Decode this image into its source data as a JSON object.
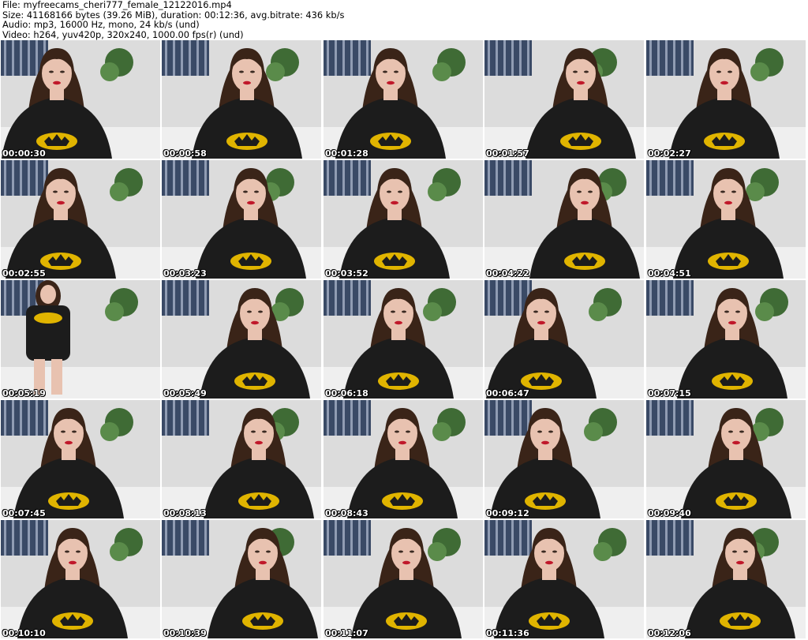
{
  "header": {
    "file_line": "File: myfreecams_cheri777_female_12122016.mp4",
    "size_line": "Size: 41168166 bytes (39.26 MiB), duration: 00:12:36, avg.bitrate: 436 kb/s",
    "audio_line": "Audio: mp3, 16000 Hz, mono, 24 kb/s (und)",
    "video_line": "Video: h264, yuv420p, 320x240, 1000.00 fps(r) (und)"
  },
  "thumbnails": [
    {
      "timestamp": "00:00:30"
    },
    {
      "timestamp": "00:00:58"
    },
    {
      "timestamp": "00:01:28"
    },
    {
      "timestamp": "00:01:57"
    },
    {
      "timestamp": "00:02:27"
    },
    {
      "timestamp": "00:02:55"
    },
    {
      "timestamp": "00:03:23"
    },
    {
      "timestamp": "00:03:52"
    },
    {
      "timestamp": "00:04:22"
    },
    {
      "timestamp": "00:04:51"
    },
    {
      "timestamp": "00:05:19"
    },
    {
      "timestamp": "00:05:49"
    },
    {
      "timestamp": "00:06:18"
    },
    {
      "timestamp": "00:06:47"
    },
    {
      "timestamp": "00:07:15"
    },
    {
      "timestamp": "00:07:45"
    },
    {
      "timestamp": "00:08:13"
    },
    {
      "timestamp": "00:08:43"
    },
    {
      "timestamp": "00:09:12"
    },
    {
      "timestamp": "00:09:40"
    },
    {
      "timestamp": "00:10:10"
    },
    {
      "timestamp": "00:10:39"
    },
    {
      "timestamp": "00:11:07"
    },
    {
      "timestamp": "00:11:36"
    },
    {
      "timestamp": "00:12:06"
    }
  ],
  "colors": {
    "wall": "#dcdcdc",
    "curtain": "#3a4a66",
    "plant": "#3f6b35",
    "hair": "#3a2418",
    "skin": "#e8c2b0",
    "shirt": "#1c1c1c",
    "logo": "#e0b400",
    "floor": "#efefef"
  }
}
